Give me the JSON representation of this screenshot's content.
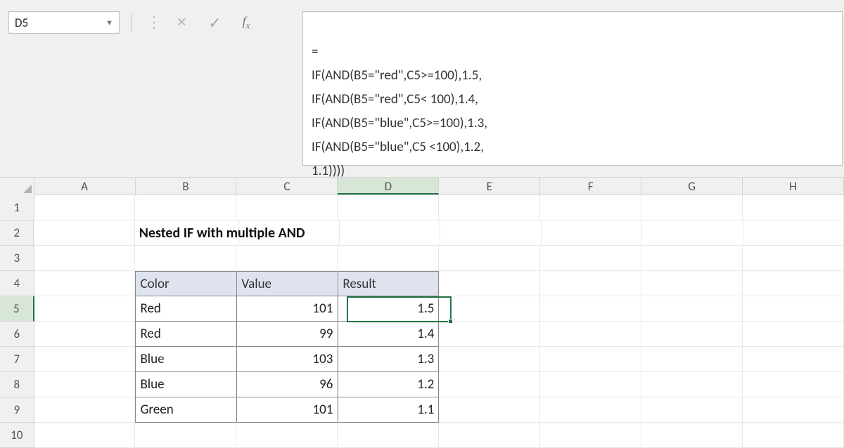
{
  "namebox": {
    "cell_ref": "D5"
  },
  "formula_bar": {
    "lines": [
      "=",
      "IF(AND(B5=\"red\",C5>=100),1.5,",
      "IF(AND(B5=\"red\",C5< 100),1.4,",
      "IF(AND(B5=\"blue\",C5>=100),1.3,",
      "IF(AND(B5=\"blue\",C5 <100),1.2,",
      "1.1))))"
    ]
  },
  "columns": [
    "A",
    "B",
    "C",
    "D",
    "E",
    "F",
    "G",
    "H"
  ],
  "row_numbers": [
    "1",
    "2",
    "3",
    "4",
    "5",
    "6",
    "7",
    "8",
    "9",
    "10"
  ],
  "title": "Nested IF with multiple AND",
  "table": {
    "headers": {
      "color": "Color",
      "value": "Value",
      "result": "Result"
    },
    "rows": [
      {
        "color": "Red",
        "value": "101",
        "result": "1.5"
      },
      {
        "color": "Red",
        "value": "99",
        "result": "1.4"
      },
      {
        "color": "Blue",
        "value": "103",
        "result": "1.3"
      },
      {
        "color": "Blue",
        "value": "96",
        "result": "1.2"
      },
      {
        "color": "Green",
        "value": "101",
        "result": "1.1"
      }
    ]
  },
  "selected_cell": "D5"
}
